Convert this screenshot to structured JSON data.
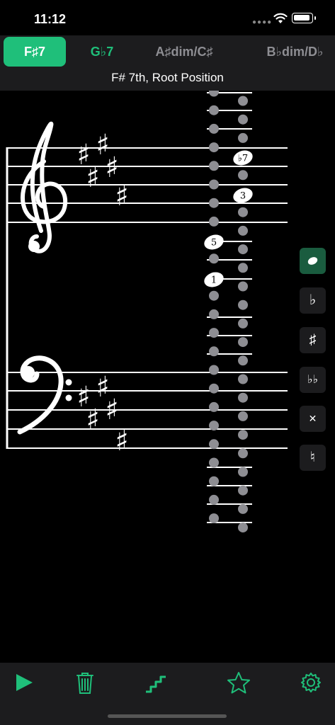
{
  "status": {
    "time": "11:12"
  },
  "chords": [
    {
      "label": "F♯7",
      "state": "selected"
    },
    {
      "label": "G♭7",
      "state": "alternate"
    },
    {
      "label": "A♯dim/C♯",
      "state": "normal"
    },
    {
      "label": "B♭dim/D♭",
      "state": "normal"
    }
  ],
  "subtitle": "F# 7th, Root Position",
  "notes": [
    {
      "label": "♭7"
    },
    {
      "label": "3"
    },
    {
      "label": "5"
    },
    {
      "label": "1"
    }
  ],
  "accidentals": {
    "sharp": "♯"
  },
  "side_tools": [
    {
      "name": "whole-note-tool",
      "label": "",
      "selected": true
    },
    {
      "name": "flat-tool",
      "label": "♭",
      "selected": false
    },
    {
      "name": "sharp-tool",
      "label": "♯",
      "selected": false
    },
    {
      "name": "double-flat-tool",
      "label": "♭♭",
      "selected": false
    },
    {
      "name": "double-sharp-tool",
      "label": "✕",
      "selected": false
    },
    {
      "name": "natural-tool",
      "label": "♮",
      "selected": false
    }
  ],
  "bottom_bar": {
    "icons": [
      "play-icon",
      "trash-icon",
      "steps-icon",
      "star-icon",
      "gear-icon"
    ],
    "accent": "#1fbf7a"
  }
}
